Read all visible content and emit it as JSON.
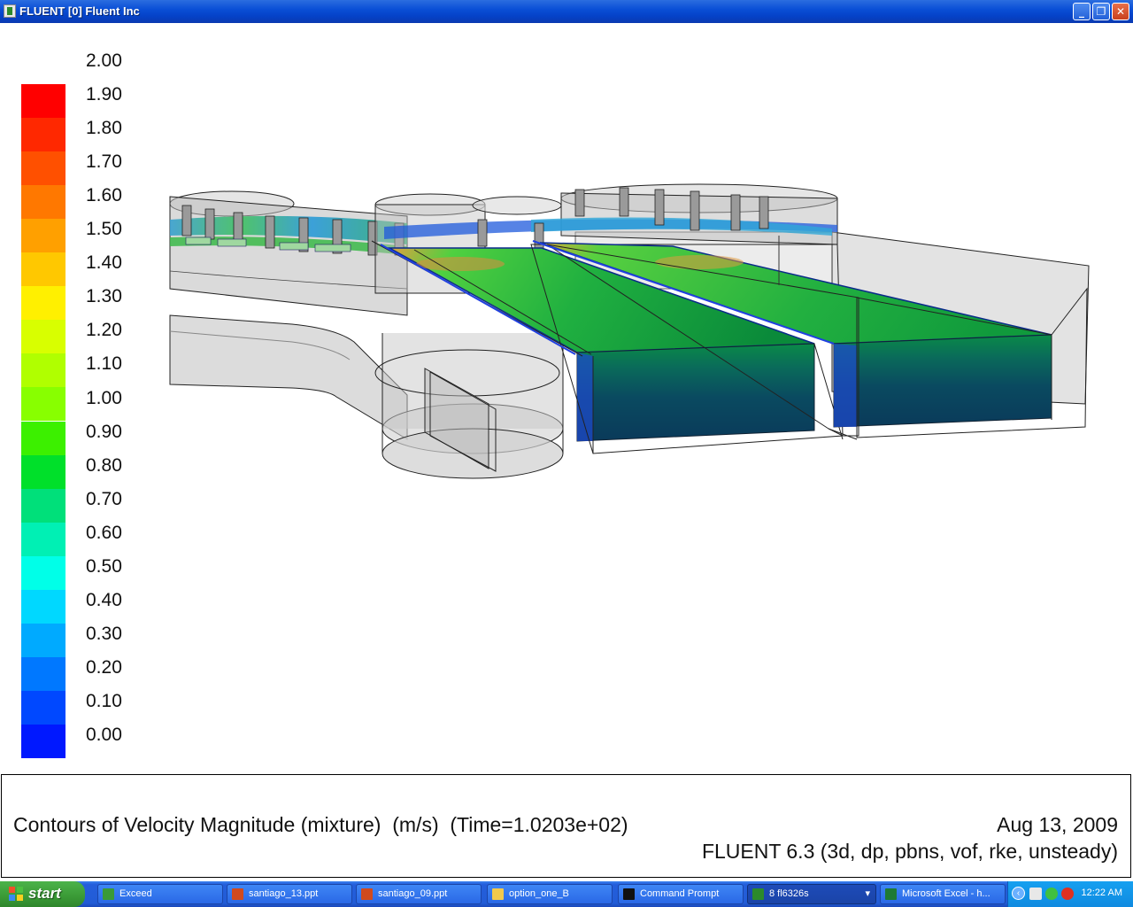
{
  "window": {
    "title": "FLUENT [0] Fluent Inc",
    "minimize_glyph": "_",
    "restore_glyph": "❐",
    "close_glyph": "✕"
  },
  "colorbar": {
    "labels": [
      "2.00",
      "1.90",
      "1.80",
      "1.70",
      "1.60",
      "1.50",
      "1.40",
      "1.30",
      "1.20",
      "1.10",
      "1.00",
      "0.90",
      "0.80",
      "0.70",
      "0.60",
      "0.50",
      "0.40",
      "0.30",
      "0.20",
      "0.10",
      "0.00"
    ],
    "colors": [
      "#ff0000",
      "#ff2800",
      "#ff5000",
      "#ff7800",
      "#ffa000",
      "#ffc800",
      "#fff000",
      "#d8ff00",
      "#b0ff00",
      "#88ff00",
      "#3cf000",
      "#00e02a",
      "#00e07a",
      "#00f0b4",
      "#00ffe8",
      "#00d8ff",
      "#00aaff",
      "#0078ff",
      "#0048ff",
      "#0018ff"
    ]
  },
  "caption": {
    "main": "Contours of Velocity Magnitude (mixture)  (m/s)  (Time=1.0203e+02)",
    "date": "Aug 13, 2009",
    "solver": "FLUENT 6.3 (3d, dp, pbns, vof, rke, unsteady)"
  },
  "taskbar": {
    "start_label": "start",
    "tasks": [
      {
        "label": "Exceed",
        "icon": "exceed-icon",
        "color": "#3a9a36"
      },
      {
        "label": "santiago_13.ppt",
        "icon": "powerpoint-icon",
        "color": "#d04a1e"
      },
      {
        "label": "santiago_09.ppt",
        "icon": "powerpoint-icon",
        "color": "#d04a1e"
      },
      {
        "label": "option_one_B",
        "icon": "folder-icon",
        "color": "#f2c94c"
      },
      {
        "label": "Command Prompt",
        "icon": "command-prompt-icon",
        "color": "#111111"
      },
      {
        "label": "8  fl6326s",
        "icon": "fluent-group-icon",
        "color": "#2c8a2c",
        "arrow": "▾"
      },
      {
        "label": "Microsoft Excel - h...",
        "icon": "excel-icon",
        "color": "#1e7a34"
      }
    ],
    "tray_arrow_glyph": "‹",
    "clock": "12:22 AM"
  }
}
